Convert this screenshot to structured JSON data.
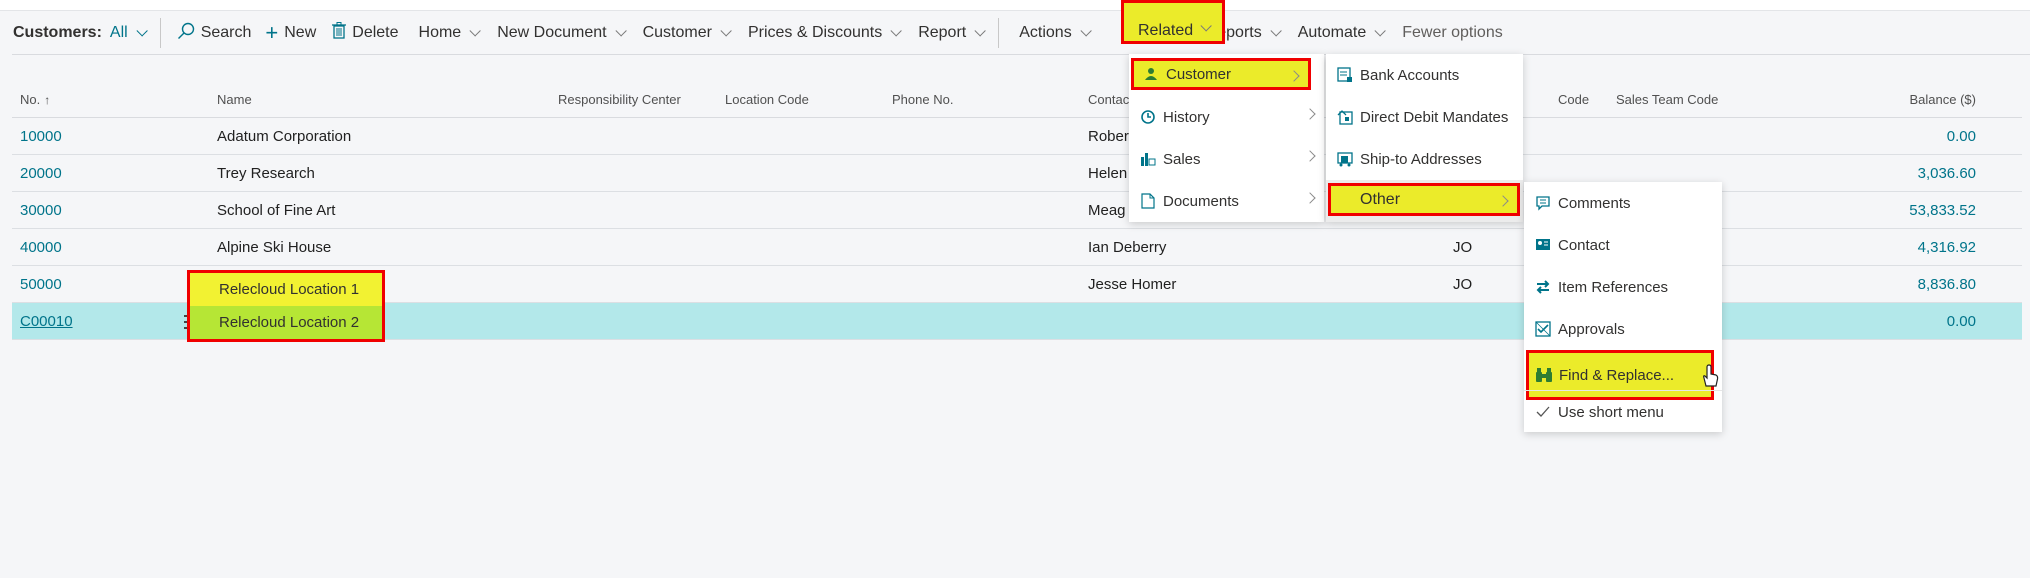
{
  "toolbar": {
    "title": "Customers:",
    "filter": "All",
    "items": [
      {
        "label": "Search",
        "icon": "search-icon"
      },
      {
        "label": "New",
        "icon": "plus-icon"
      },
      {
        "label": "Delete",
        "icon": "trash-icon"
      },
      {
        "label": "Home"
      },
      {
        "label": "New Document"
      },
      {
        "label": "Customer"
      },
      {
        "label": "Prices & Discounts"
      },
      {
        "label": "Report"
      },
      {
        "label": "Actions"
      },
      {
        "label": "Related"
      },
      {
        "label": "Reports"
      },
      {
        "label": "Automate"
      },
      {
        "label": "Fewer options"
      }
    ]
  },
  "grid": {
    "columns": {
      "no": "No.",
      "sort_indicator": "↑",
      "name": "Name",
      "responsibility_center": "Responsibility Center",
      "location_code": "Location Code",
      "phone_no": "Phone No.",
      "contact": "Contac",
      "code": "Code",
      "sales_team_code": "Sales Team Code",
      "balance": "Balance ($)"
    },
    "rows": [
      {
        "no": "10000",
        "name": "Adatum Corporation",
        "contact": "Rober",
        "code": "",
        "balance": "0.00"
      },
      {
        "no": "20000",
        "name": "Trey Research",
        "contact": "Helen",
        "code": "",
        "balance": "3,036.60"
      },
      {
        "no": "30000",
        "name": "School of Fine Art",
        "contact": "Meag",
        "code": "",
        "balance": "53,833.52"
      },
      {
        "no": "40000",
        "name": "Alpine Ski House",
        "contact": "Ian Deberry",
        "code": "JO",
        "balance": "4,316.92"
      },
      {
        "no": "50000",
        "name": "Relecloud Location 1",
        "contact": "Jesse Homer",
        "code": "JO",
        "balance": "8,836.80"
      },
      {
        "no": "C00010",
        "name": "Relecloud Location 2",
        "contact": "",
        "code": "",
        "balance": "0.00"
      }
    ]
  },
  "related_menu": {
    "items": [
      {
        "label": "Customer",
        "icon": "person-icon"
      },
      {
        "label": "History",
        "icon": "history-icon"
      },
      {
        "label": "Sales",
        "icon": "sales-icon"
      },
      {
        "label": "Documents",
        "icon": "document-icon"
      }
    ]
  },
  "customer_submenu": {
    "items": [
      {
        "label": "Bank Accounts",
        "icon": "bank-accounts-icon"
      },
      {
        "label": "Direct Debit Mandates",
        "icon": "direct-debit-icon"
      },
      {
        "label": "Ship-to Addresses",
        "icon": "ship-to-icon"
      },
      {
        "label": "Other"
      }
    ]
  },
  "other_submenu": {
    "items": [
      {
        "label": "Comments",
        "icon": "comment-icon"
      },
      {
        "label": "Contact",
        "icon": "contact-card-icon"
      },
      {
        "label": "Item References",
        "icon": "swap-arrows-icon"
      },
      {
        "label": "Approvals",
        "icon": "approvals-icon"
      },
      {
        "label": "Find & Replace...",
        "icon": "binoculars-icon"
      },
      {
        "label": "Use short menu",
        "icon": "checkmark-icon"
      }
    ]
  },
  "colors": {
    "accent": "#00748a",
    "highlight_yellow": "#ebeb2a",
    "highlight_red": "#f00000",
    "selected_row": "#b3e8ea"
  }
}
